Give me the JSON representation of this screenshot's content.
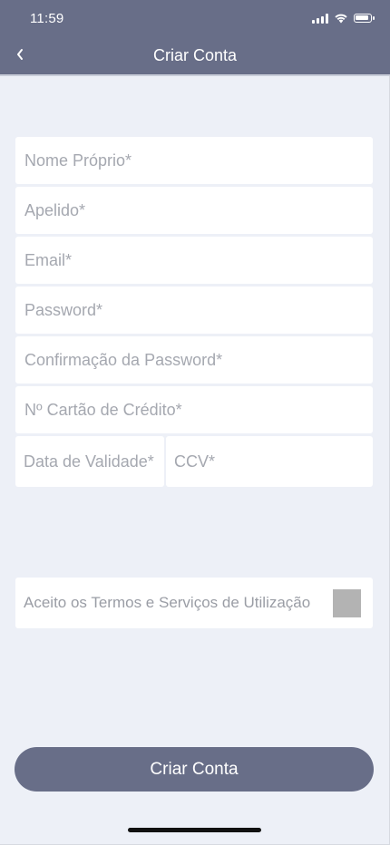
{
  "status_bar": {
    "time": "11:59"
  },
  "header": {
    "title": "Criar Conta",
    "back_icon": "chevron-left-icon"
  },
  "form": {
    "first_name": {
      "placeholder": "Nome Próprio*"
    },
    "last_name": {
      "placeholder": "Apelido*"
    },
    "email": {
      "placeholder": "Email*"
    },
    "password": {
      "placeholder": "Password*"
    },
    "password_confirm": {
      "placeholder": "Confirmação da Password*"
    },
    "card_number": {
      "placeholder": "Nº Cartão de Crédito*"
    },
    "expiry": {
      "placeholder": "Data de Validade*"
    },
    "ccv": {
      "placeholder": "CCV*"
    }
  },
  "terms": {
    "label": "Aceito os Termos e Serviços de Utilização",
    "checked": false
  },
  "submit": {
    "label": "Criar Conta"
  },
  "colors": {
    "header_bg": "#686e88",
    "page_bg": "#edf0f7",
    "field_bg": "#ffffff",
    "placeholder": "#a5a8b0",
    "checkbox": "#b3b3b3",
    "button_bg": "#686e88"
  }
}
